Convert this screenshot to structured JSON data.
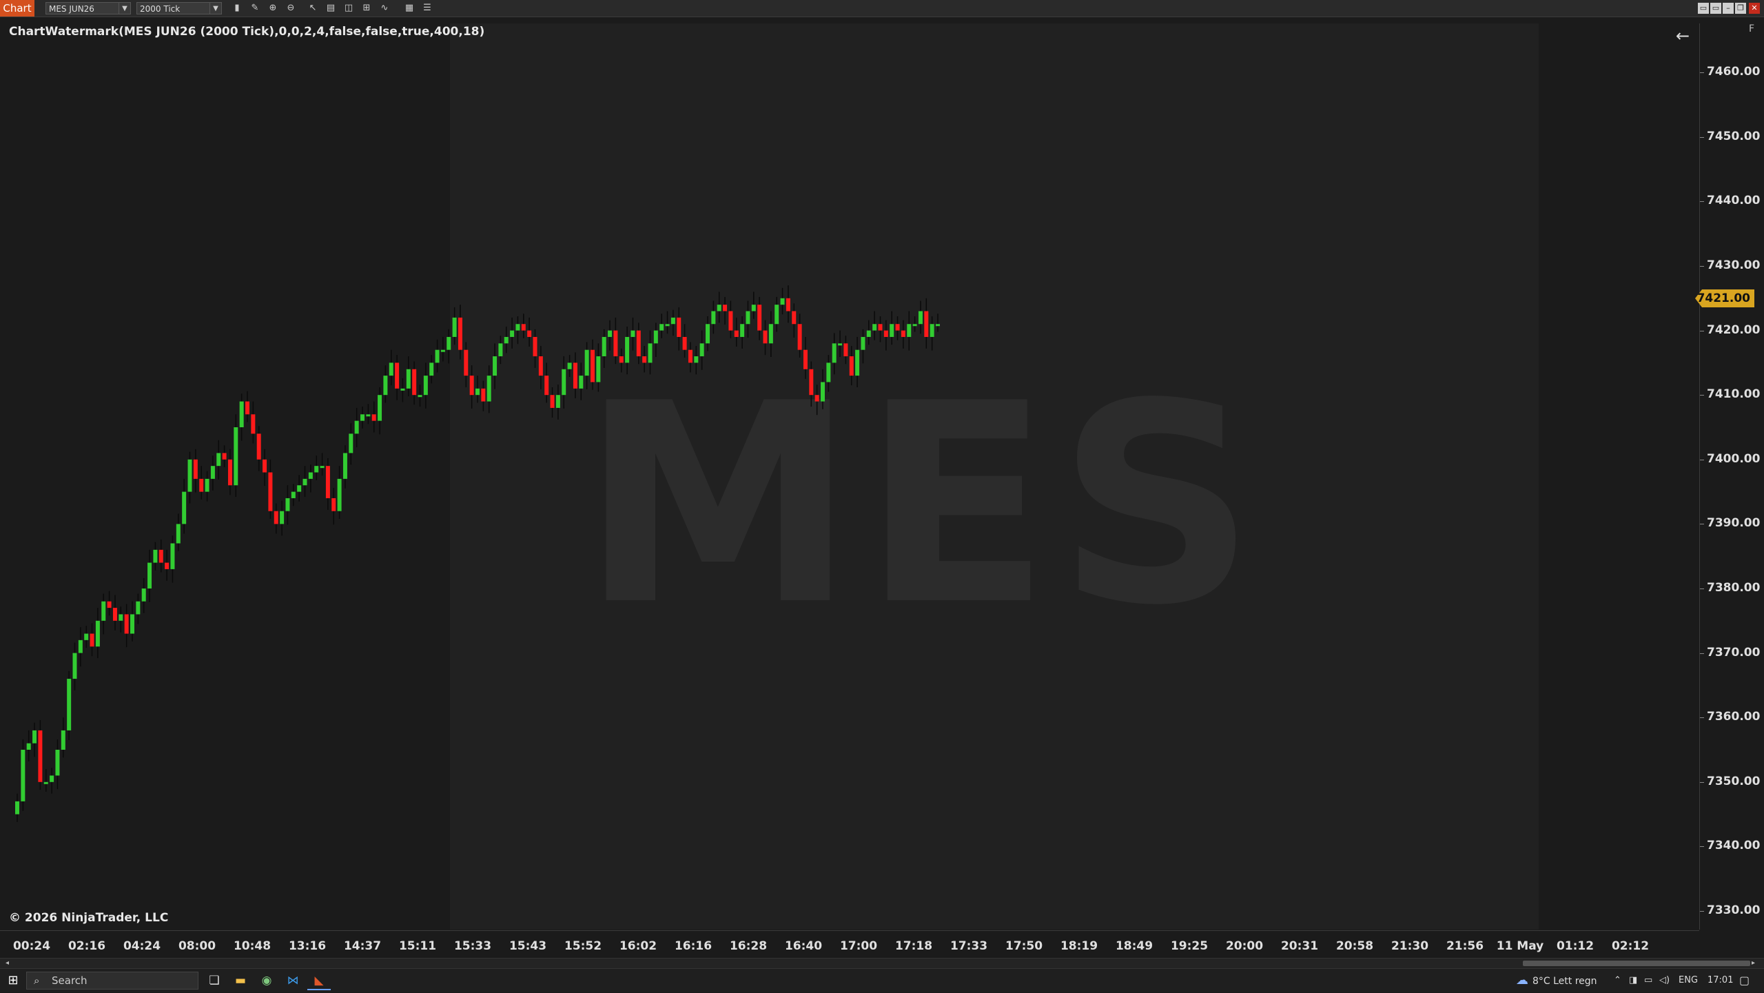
{
  "window": {
    "app_tab": "Chart",
    "instrument": "MES JUN26",
    "interval": "2000 Tick"
  },
  "chart": {
    "indicator_label": "ChartWatermark(MES JUN26 (2000 Tick),0,0,2,4,false,false,true,400,18)",
    "watermark": "MES",
    "copyright": "© 2026 NinjaTrader, LLC",
    "current_price": "7421.00",
    "axis_flag": "F",
    "up_color": "#32cd32",
    "down_color": "#ff1a1a"
  },
  "chart_data": {
    "type": "candlestick",
    "title": "",
    "ylim": [
      7324,
      7465
    ],
    "y_ticks": [
      "7460.00",
      "7450.00",
      "7440.00",
      "7430.00",
      "7420.00",
      "7410.00",
      "7400.00",
      "7390.00",
      "7380.00",
      "7370.00",
      "7360.00",
      "7350.00",
      "7340.00",
      "7330.00"
    ],
    "x_ticks": [
      "00:24",
      "02:16",
      "04:24",
      "08:00",
      "10:48",
      "13:16",
      "14:37",
      "15:11",
      "15:33",
      "15:43",
      "15:52",
      "16:02",
      "16:16",
      "16:28",
      "16:40",
      "17:00",
      "17:18",
      "17:33",
      "17:50",
      "18:19",
      "18:49",
      "19:25",
      "20:00",
      "20:31",
      "20:58",
      "21:30",
      "21:56",
      "11 May",
      "01:12",
      "02:12"
    ],
    "closes": [
      7347,
      7355,
      7356,
      7358,
      7350,
      7350,
      7351,
      7355,
      7358,
      7366,
      7370,
      7372,
      7373,
      7371,
      7375,
      7378,
      7377,
      7375,
      7376,
      7373,
      7376,
      7378,
      7380,
      7384,
      7386,
      7384,
      7383,
      7387,
      7390,
      7395,
      7400,
      7397,
      7395,
      7397,
      7399,
      7401,
      7400,
      7396,
      7405,
      7409,
      7407,
      7404,
      7400,
      7398,
      7392,
      7390,
      7392,
      7394,
      7395,
      7396,
      7397,
      7398,
      7399,
      7399,
      7394,
      7392,
      7397,
      7401,
      7404,
      7406,
      7407,
      7407,
      7406,
      7410,
      7413,
      7415,
      7411,
      7411,
      7414,
      7410,
      7410,
      7413,
      7415,
      7417,
      7417,
      7419,
      7422,
      7417,
      7413,
      7410,
      7411,
      7409,
      7413,
      7416,
      7418,
      7419,
      7420,
      7421,
      7420,
      7419,
      7416,
      7413,
      7410,
      7408,
      7410,
      7414,
      7415,
      7411,
      7413,
      7417,
      7412,
      7416,
      7419,
      7420,
      7416,
      7415,
      7419,
      7420,
      7416,
      7415,
      7418,
      7420,
      7421,
      7421,
      7422,
      7419,
      7417,
      7415,
      7416,
      7418,
      7421,
      7423,
      7424,
      7423,
      7420,
      7419,
      7421,
      7423,
      7424,
      7420,
      7418,
      7421,
      7424,
      7425,
      7423,
      7421,
      7417,
      7414,
      7410,
      7409,
      7412,
      7415,
      7418,
      7418,
      7416,
      7413,
      7417,
      7419,
      7420,
      7421,
      7420,
      7419,
      7421,
      7420,
      7419,
      7421,
      7421,
      7423,
      7419,
      7421,
      7421
    ]
  },
  "price_axis": {
    "labels": [
      "7460.00",
      "7450.00",
      "7440.00",
      "7430.00",
      "7420.00",
      "7410.00",
      "7400.00",
      "7390.00",
      "7380.00",
      "7370.00",
      "7360.00",
      "7350.00",
      "7340.00",
      "7330.00"
    ]
  },
  "time_axis": {
    "labels": [
      "00:24",
      "02:16",
      "04:24",
      "08:00",
      "10:48",
      "13:16",
      "14:37",
      "15:11",
      "15:33",
      "15:43",
      "15:52",
      "16:02",
      "16:16",
      "16:28",
      "16:40",
      "17:00",
      "17:18",
      "17:33",
      "17:50",
      "18:19",
      "18:49",
      "19:25",
      "20:00",
      "20:31",
      "20:58",
      "21:30",
      "21:56",
      "11 May",
      "01:12",
      "02:12"
    ]
  },
  "taskbar": {
    "search_placeholder": "Search",
    "weather": "8°C  Lett regn",
    "lang": "ENG",
    "time": "17:01"
  }
}
